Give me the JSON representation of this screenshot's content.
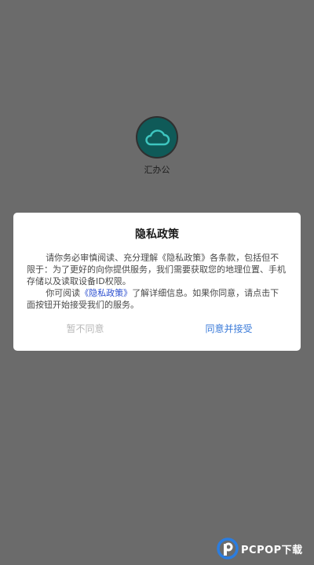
{
  "app": {
    "name": "汇办公",
    "icon": "cloud-icon"
  },
  "dialog": {
    "title": "隐私政策",
    "paragraph1": "请你务必审慎阅读、充分理解《隐私政策》各条款，包括但不限于：为了更好的向你提供服务，我们需要获取您的地理位置、手机存储以及读取设备ID权限。",
    "paragraph2_before": "你可阅读",
    "paragraph2_link": "《隐私政策》",
    "paragraph2_after": "了解详细信息。如果你同意，请点击下面按钮开始接受我们的服务。",
    "decline_label": "暂不同意",
    "accept_label": "同意并接受"
  },
  "watermark": {
    "text": "PCPOP下载"
  },
  "colors": {
    "background": "#6b6b6b",
    "icon_bg": "#0f5a58",
    "link": "#2c4fd0",
    "accept": "#3b7bd9",
    "decline": "#b8b8b8"
  }
}
